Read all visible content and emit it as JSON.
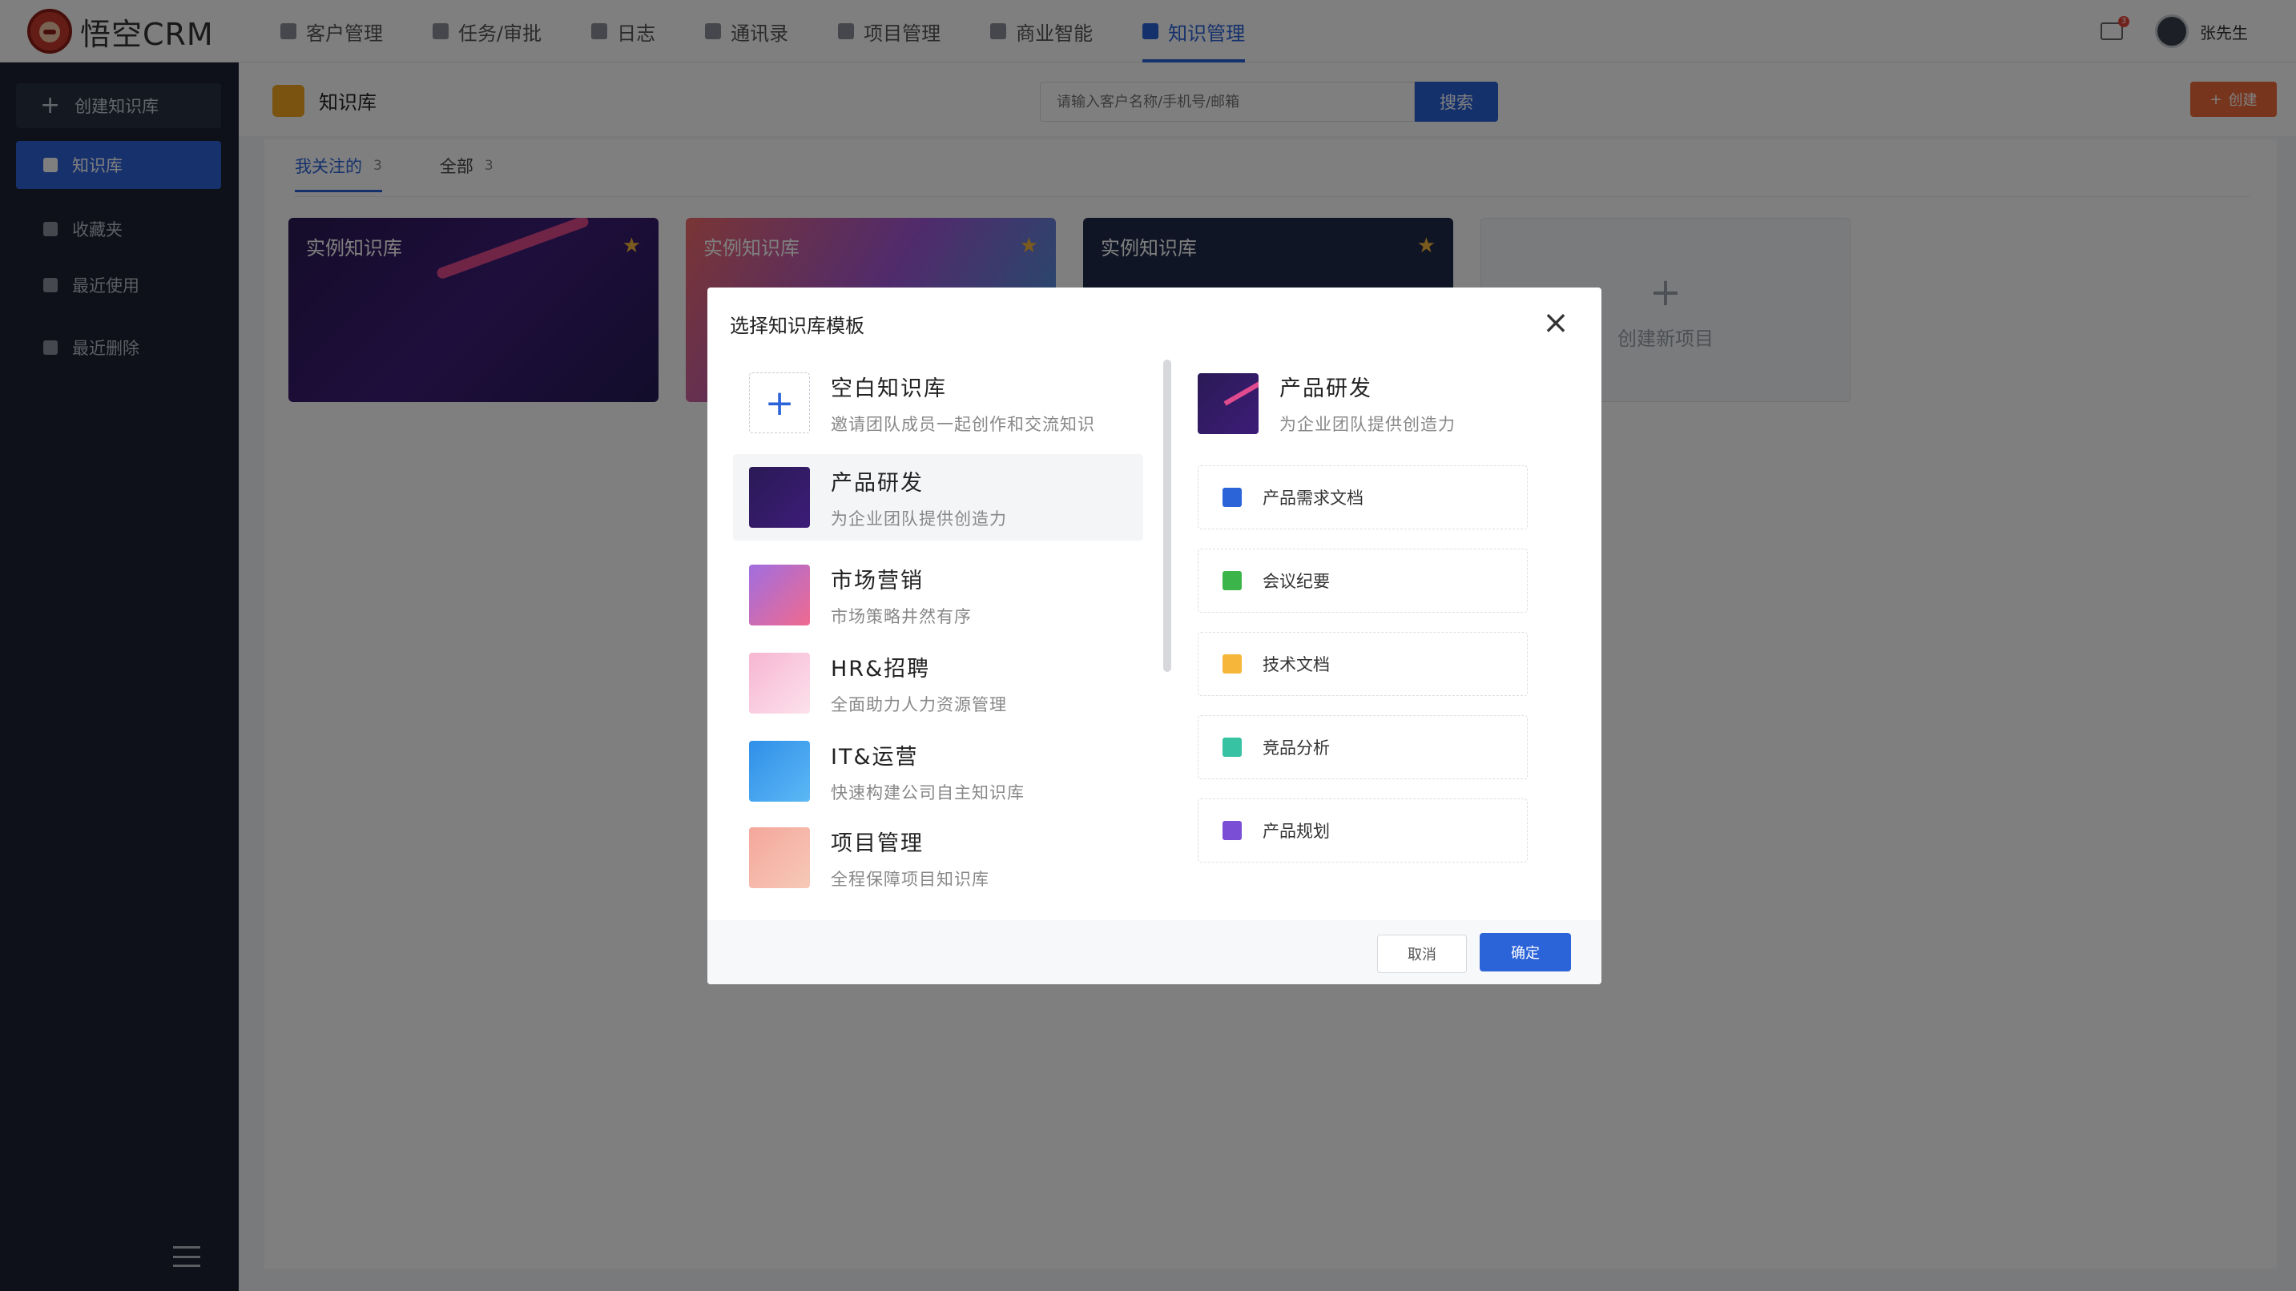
{
  "app": {
    "logo_text": "悟空CRM"
  },
  "nav": {
    "items": [
      {
        "label": "客户管理",
        "icon": "customer-icon"
      },
      {
        "label": "任务/审批",
        "icon": "task-icon"
      },
      {
        "label": "日志",
        "icon": "log-icon"
      },
      {
        "label": "通讯录",
        "icon": "contacts-icon"
      },
      {
        "label": "项目管理",
        "icon": "project-icon"
      },
      {
        "label": "商业智能",
        "icon": "bi-icon"
      },
      {
        "label": "知识管理",
        "icon": "knowledge-icon",
        "active": true
      }
    ],
    "mail_badge": "3",
    "user_name": "张先生",
    "accent": "#2b63d9"
  },
  "sidebar": {
    "create_label": "创建知识库",
    "items": [
      {
        "label": "知识库",
        "icon": "book-icon",
        "active": true
      },
      {
        "label": "收藏夹",
        "icon": "star-icon"
      },
      {
        "label": "最近使用",
        "icon": "clock-icon"
      },
      {
        "label": "最近删除",
        "icon": "trash-icon"
      }
    ]
  },
  "page": {
    "title": "知识库",
    "search_placeholder": "请输入客户名称/手机号/邮箱",
    "search_button": "搜索",
    "create_button": "创建",
    "tabs": [
      {
        "label": "我关注的",
        "count": "3",
        "active": true
      },
      {
        "label": "全部",
        "count": "3"
      }
    ],
    "cards": [
      {
        "label": "实例知识库"
      },
      {
        "label": "实例知识库"
      },
      {
        "label": "实例知识库"
      }
    ],
    "new_card_label": "创建新项目"
  },
  "modal": {
    "title": "选择知识库模板",
    "templates": [
      {
        "name": "空白知识库",
        "desc": "邀请团队成员一起创作和交流知识",
        "icon": "plus-icon"
      },
      {
        "name": "产品研发",
        "desc": "为企业团队提供创造力",
        "selected": true
      },
      {
        "name": "市场营销",
        "desc": "市场策略井然有序"
      },
      {
        "name": "HR&招聘",
        "desc": "全面助力人力资源管理"
      },
      {
        "name": "IT&运营",
        "desc": "快速构建公司自主知识库"
      },
      {
        "name": "项目管理",
        "desc": "全程保障项目知识库"
      }
    ],
    "detail": {
      "name": "产品研发",
      "desc": "为企业团队提供创造力",
      "docs": [
        {
          "label": "产品需求文档",
          "icon": "doc-icon",
          "color": "#2b63d9"
        },
        {
          "label": "会议纪要",
          "icon": "bookmark-icon",
          "color": "#3bb54a"
        },
        {
          "label": "技术文档",
          "icon": "briefcase-icon",
          "color": "#f5b63a"
        },
        {
          "label": "竞品分析",
          "icon": "chart-icon",
          "color": "#36c2a3"
        },
        {
          "label": "产品规划",
          "icon": "layers-icon",
          "color": "#7a4fd6"
        }
      ]
    },
    "cancel_label": "取消",
    "ok_label": "确定"
  }
}
